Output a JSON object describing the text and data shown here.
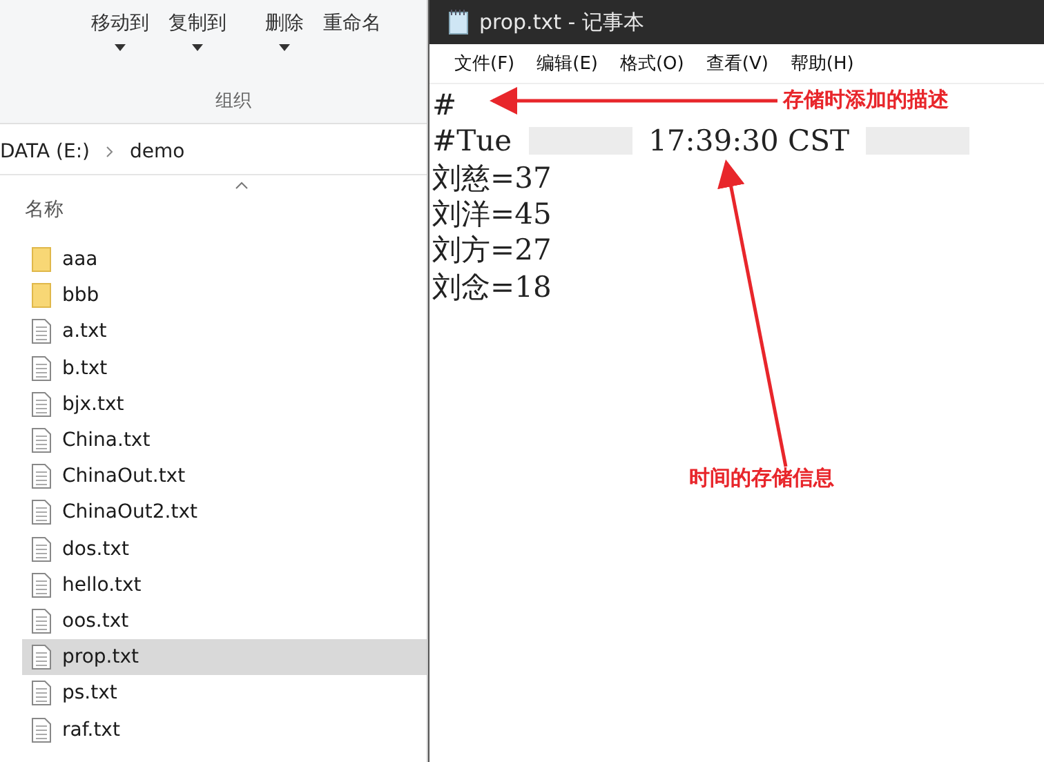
{
  "explorer": {
    "ribbon": {
      "buttons": [
        {
          "label": "移动到",
          "dropdown": true
        },
        {
          "label": "复制到",
          "dropdown": true
        },
        {
          "label": "删除",
          "dropdown": true
        },
        {
          "label": "重命名",
          "dropdown": false
        }
      ],
      "group_label": "组织"
    },
    "breadcrumb": [
      "DATA (E:)",
      "demo"
    ],
    "column_header": "名称",
    "files": [
      {
        "name": "aaa",
        "kind": "folder",
        "selected": false
      },
      {
        "name": "bbb",
        "kind": "folder",
        "selected": false
      },
      {
        "name": "a.txt",
        "kind": "file",
        "selected": false
      },
      {
        "name": "b.txt",
        "kind": "file",
        "selected": false
      },
      {
        "name": "bjx.txt",
        "kind": "file",
        "selected": false
      },
      {
        "name": "China.txt",
        "kind": "file",
        "selected": false
      },
      {
        "name": "ChinaOut.txt",
        "kind": "file",
        "selected": false
      },
      {
        "name": "ChinaOut2.txt",
        "kind": "file",
        "selected": false
      },
      {
        "name": "dos.txt",
        "kind": "file",
        "selected": false
      },
      {
        "name": "hello.txt",
        "kind": "file",
        "selected": false
      },
      {
        "name": "oos.txt",
        "kind": "file",
        "selected": false
      },
      {
        "name": "prop.txt",
        "kind": "file",
        "selected": true
      },
      {
        "name": "ps.txt",
        "kind": "file",
        "selected": false
      },
      {
        "name": "raf.txt",
        "kind": "file",
        "selected": false
      }
    ]
  },
  "notepad": {
    "title": "prop.txt - 记事本",
    "menu": [
      "文件(F)",
      "编辑(E)",
      "格式(O)",
      "查看(V)",
      "帮助(H)"
    ],
    "lines": [
      [
        {
          "kind": "text",
          "text": "#"
        }
      ],
      [
        {
          "kind": "text",
          "text": "#Tue"
        },
        {
          "kind": "redacted"
        },
        {
          "kind": "text",
          "text": "17:39:30 CST"
        },
        {
          "kind": "redacted"
        }
      ],
      [
        {
          "kind": "text",
          "text": "刘慈=37"
        }
      ],
      [
        {
          "kind": "text",
          "text": "刘洋=45"
        }
      ],
      [
        {
          "kind": "text",
          "text": "刘方=27"
        }
      ],
      [
        {
          "kind": "text",
          "text": "刘念=18"
        }
      ]
    ]
  },
  "annotations": [
    {
      "text": "存储时添加的描述",
      "kind": "horizontal"
    },
    {
      "text": "时间的存储信息",
      "kind": "upward"
    }
  ]
}
